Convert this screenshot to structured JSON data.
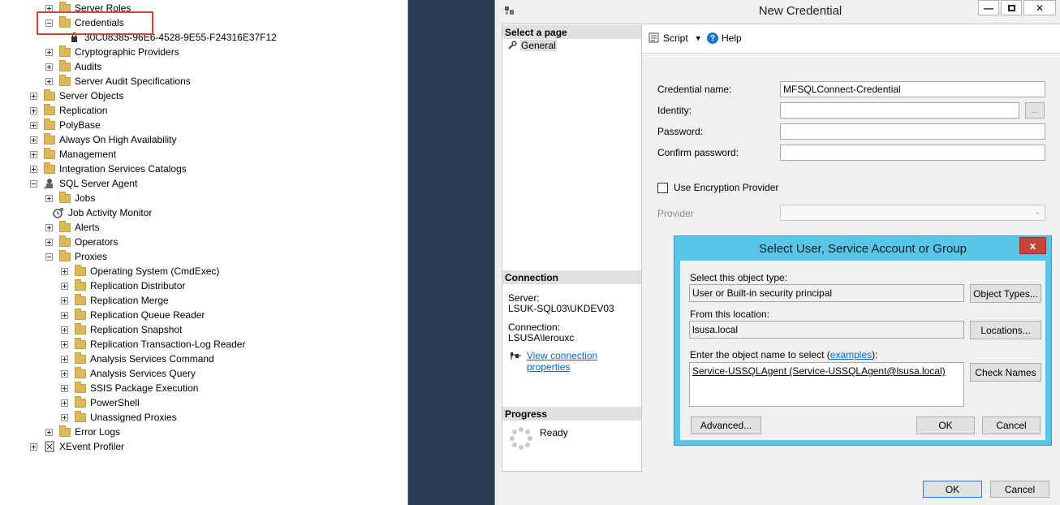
{
  "tree": {
    "items": [
      {
        "label": "Server Roles",
        "icon": "folder-icon",
        "expander": "plus"
      },
      {
        "label": "Credentials",
        "icon": "folder-icon",
        "expander": "minus"
      },
      {
        "label": "30C08385-96E6-4528-9E55-F24316E37F12",
        "icon": "credential-icon",
        "expander": "none"
      },
      {
        "label": "Cryptographic Providers",
        "icon": "folder-icon",
        "expander": "plus"
      },
      {
        "label": "Audits",
        "icon": "folder-icon",
        "expander": "plus"
      },
      {
        "label": "Server Audit Specifications",
        "icon": "folder-icon",
        "expander": "plus"
      },
      {
        "label": "Server Objects",
        "icon": "folder-icon",
        "expander": "plus"
      },
      {
        "label": "Replication",
        "icon": "folder-icon",
        "expander": "plus"
      },
      {
        "label": "PolyBase",
        "icon": "folder-icon",
        "expander": "plus"
      },
      {
        "label": "Always On High Availability",
        "icon": "folder-icon",
        "expander": "plus"
      },
      {
        "label": "Management",
        "icon": "folder-icon",
        "expander": "plus"
      },
      {
        "label": "Integration Services Catalogs",
        "icon": "folder-icon",
        "expander": "plus"
      },
      {
        "label": "SQL Server Agent",
        "icon": "sql-agent-icon",
        "expander": "minus"
      },
      {
        "label": "Jobs",
        "icon": "folder-icon",
        "expander": "plus"
      },
      {
        "label": "Job Activity Monitor",
        "icon": "monitor-icon",
        "expander": "none"
      },
      {
        "label": "Alerts",
        "icon": "folder-icon",
        "expander": "plus"
      },
      {
        "label": "Operators",
        "icon": "folder-icon",
        "expander": "plus"
      },
      {
        "label": "Proxies",
        "icon": "folder-icon",
        "expander": "minus"
      },
      {
        "label": "Operating System (CmdExec)",
        "icon": "folder-icon",
        "expander": "plus"
      },
      {
        "label": "Replication Distributor",
        "icon": "folder-icon",
        "expander": "plus"
      },
      {
        "label": "Replication Merge",
        "icon": "folder-icon",
        "expander": "plus"
      },
      {
        "label": "Replication Queue Reader",
        "icon": "folder-icon",
        "expander": "plus"
      },
      {
        "label": "Replication Snapshot",
        "icon": "folder-icon",
        "expander": "plus"
      },
      {
        "label": "Replication Transaction-Log Reader",
        "icon": "folder-icon",
        "expander": "plus"
      },
      {
        "label": "Analysis Services Command",
        "icon": "folder-icon",
        "expander": "plus"
      },
      {
        "label": "Analysis Services Query",
        "icon": "folder-icon",
        "expander": "plus"
      },
      {
        "label": "SSIS Package Execution",
        "icon": "folder-icon",
        "expander": "plus"
      },
      {
        "label": "PowerShell",
        "icon": "folder-icon",
        "expander": "plus"
      },
      {
        "label": "Unassigned Proxies",
        "icon": "folder-icon",
        "expander": "plus"
      },
      {
        "label": "Error Logs",
        "icon": "folder-icon",
        "expander": "plus"
      },
      {
        "label": "XEvent Profiler",
        "icon": "xevent-icon",
        "expander": "plus"
      }
    ]
  },
  "credential_window": {
    "title": "New Credential",
    "select_page_header": "Select a page",
    "pages": [
      "General"
    ],
    "toolbar": {
      "script_label": "Script",
      "help_label": "Help"
    },
    "form": {
      "credential_name_label": "Credential name:",
      "credential_name_value": "MFSQLConnect-Credential",
      "identity_label": "Identity:",
      "identity_value": "",
      "browse_label": "...",
      "password_label": "Password:",
      "password_value": "",
      "confirm_password_label": "Confirm password:",
      "confirm_password_value": "",
      "use_encryption_label": "Use Encryption Provider",
      "provider_label": "Provider",
      "provider_value": ""
    },
    "connection": {
      "header": "Connection",
      "server_label": "Server:",
      "server_value": "LSUK-SQL03\\UKDEV03",
      "connection_label": "Connection:",
      "connection_value": "LSUSA\\lerouxc",
      "view_properties_link": "View connection properties"
    },
    "progress": {
      "header": "Progress",
      "status": "Ready"
    },
    "ok_label": "OK",
    "cancel_label": "Cancel"
  },
  "select_dialog": {
    "title": "Select User, Service Account or Group",
    "close_label": "x",
    "object_type_label": "Select this object type:",
    "object_type_value": "User or Built-in security principal",
    "object_types_button": "Object Types...",
    "location_label": "From this location:",
    "location_value": "lsusa.local",
    "locations_button": "Locations...",
    "object_name_label_prefix": "Enter the object name to select (",
    "object_name_link": "examples",
    "object_name_label_suffix": "):",
    "object_name_value": "Service-USSQLAgent (Service-USSQLAgent@lsusa.local)",
    "check_names_button": "Check Names",
    "advanced_button": "Advanced...",
    "ok_label": "OK",
    "cancel_label": "Cancel"
  },
  "colors": {
    "highlight": "#e2403b",
    "dialog_frame": "#58c6e8",
    "dark_background": "#2b3a55",
    "link": "#0066cc"
  }
}
